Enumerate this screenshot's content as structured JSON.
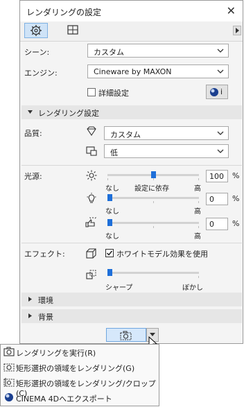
{
  "window": {
    "title": "レンダリングの設定",
    "close": "✕"
  },
  "scene": {
    "label": "シーン:",
    "value": "カスタム"
  },
  "engine": {
    "label": "エンジン:",
    "value": "Cineware by MAXON"
  },
  "advanced": {
    "label": "詳細設定",
    "checked": false,
    "info_label": "i"
  },
  "render_settings": {
    "header": "レンダリング設定",
    "quality_label": "品質:",
    "quality_value": "カスタム",
    "texture_value": "低"
  },
  "lights": {
    "label": "光源:",
    "sun": {
      "value": "100",
      "unit": "%",
      "min": "なし",
      "mid": "設定に依存",
      "max": "高",
      "level": 1.0
    },
    "bulb": {
      "value": "0",
      "unit": "%",
      "min": "なし",
      "max": "高",
      "level": 0.0
    },
    "hand": {
      "value": "0",
      "unit": "%",
      "min": "なし",
      "max": "高",
      "level": 0.0
    }
  },
  "effects": {
    "label": "エフェクト:",
    "white_model_label": "ホワイトモデル効果を使用",
    "white_model_checked": true,
    "min": "シャープ",
    "max": "ぼかし"
  },
  "sections": {
    "environment": "環境",
    "background": "背景"
  },
  "menu": {
    "items": [
      "レンダリングを実行(R)",
      "矩形選択の領域をレンダリング(G)",
      "矩形選択の領域をレンダリング/クロップ(C)",
      "CINEMA 4Dへエクスポート"
    ]
  },
  "colors": {
    "accent": "#1e6fd9",
    "selected_tab": "#cfe3f7"
  }
}
